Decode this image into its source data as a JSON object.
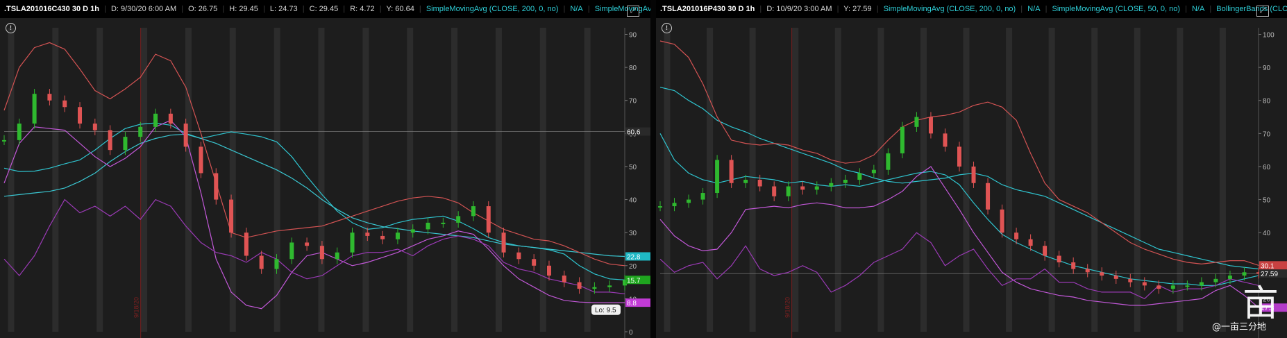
{
  "panels": [
    {
      "header": {
        "symbol": ".TSLA201016C430 30 D 1h",
        "fields": [
          "D: 9/30/20 6:00 AM",
          "O: 26.75",
          "H: 29.45",
          "L: 24.73",
          "C: 29.45",
          "R: 4.72",
          "Y: 60.64"
        ],
        "studies": [
          "SimpleMovingAvg (CLOSE, 200, 0, no)",
          "N/A",
          "SimpleMovingAvg ..."
        ]
      },
      "date_marker": "9/18/20",
      "lo_label": "Lo: 9.5"
    },
    {
      "header": {
        "symbol": ".TSLA201016P430 30 D 1h",
        "fields": [
          "D: 10/9/20 3:00 AM",
          "Y: 27.59"
        ],
        "studies": [
          "SimpleMovingAvg (CLOSE, 200, 0, no)",
          "N/A",
          "SimpleMovingAvg (CLOSE, 50, 0, no)",
          "N/A",
          "BollingerBands (CLOSE,..."
        ]
      },
      "date_marker": "9/18/20"
    }
  ],
  "chart_data": [
    {
      "type": "line",
      "symbol": ".TSLA201016C430",
      "ylim": [
        0,
        92
      ],
      "yticks": [
        0,
        10,
        20,
        30,
        40,
        50,
        60,
        70,
        80,
        90
      ],
      "right_labels": [
        {
          "value": 60.6,
          "text": "60.6",
          "color": "#2a2a2a"
        },
        {
          "value": 22.8,
          "text": "22.8",
          "color": "#1fb8c4"
        },
        {
          "value": 15.7,
          "text": "15.7",
          "color": "#1fa51f"
        },
        {
          "value": 8.8,
          "text": "8.8",
          "color": "#c23bd6"
        }
      ],
      "hline": 60.6,
      "series": [
        {
          "name": "",
          "color": "#2fc4cf",
          "values": [
            49.5,
            48.5,
            48.6,
            49.5,
            50.8,
            52,
            55,
            58.5,
            61.5,
            62.8,
            63.2,
            62.5,
            60,
            58.5,
            59.5,
            60.5,
            59.8,
            59,
            57.5,
            53,
            47,
            41.5,
            36.5,
            33,
            31,
            31.5,
            33,
            34,
            34.5,
            35,
            33.5,
            31.2,
            28.5,
            27,
            26,
            25.5,
            24.8,
            23.5,
            20,
            17.5,
            16,
            15.7
          ]
        },
        {
          "name": "",
          "color": "#3ac7d2",
          "values": [
            41,
            41.5,
            42,
            42.5,
            43.5,
            45.5,
            48,
            51.5,
            54.5,
            57,
            58.5,
            59.5,
            59.8,
            58.5,
            57,
            55,
            53,
            51,
            49,
            46.5,
            43.5,
            40,
            37,
            34.5,
            33,
            31.8,
            31.2,
            30.5,
            30,
            29.5,
            29,
            28.5,
            27.5,
            26.5,
            26,
            25.5,
            25,
            24.5,
            24,
            23.5,
            23,
            22.8
          ]
        },
        {
          "name": "",
          "color": "#d35353",
          "values": [
            67,
            80,
            86,
            87.5,
            85.5,
            79.5,
            73,
            70.5,
            73.5,
            77,
            84,
            82,
            74,
            60,
            45,
            30,
            28.5,
            29.5,
            30.5,
            31,
            31.5,
            32,
            33.5,
            35,
            36.5,
            38,
            39.5,
            40.5,
            41,
            40.5,
            39,
            36,
            33.5,
            31,
            29.5,
            28,
            27.5,
            26,
            24,
            22,
            20.5,
            20
          ]
        },
        {
          "name": "",
          "color": "#c258d8",
          "values": [
            45,
            57,
            62,
            61.5,
            61,
            57,
            53,
            50,
            52.5,
            56,
            62,
            64,
            59,
            42,
            22,
            12,
            8,
            7,
            11,
            18,
            23,
            24,
            22,
            20,
            21,
            22.5,
            24,
            26,
            28,
            29,
            30.5,
            29.5,
            25,
            20,
            16,
            13.5,
            11,
            9.5,
            9,
            8.8,
            8.8,
            8.8
          ]
        },
        {
          "name": "",
          "color": "#9a3ab5",
          "values": [
            22,
            17,
            23,
            32,
            40,
            36,
            38,
            35,
            38,
            34,
            40,
            38,
            32,
            27,
            24,
            23,
            21,
            24,
            22,
            18,
            16,
            17,
            20,
            23,
            24,
            24,
            25,
            23,
            26,
            28,
            29,
            28,
            26,
            21,
            19,
            18,
            16,
            15,
            14,
            12,
            12,
            11.5
          ]
        }
      ],
      "price": [
        58,
        63,
        72,
        70,
        68,
        63,
        61,
        55,
        59,
        62,
        66,
        63,
        56,
        48,
        40,
        30,
        23,
        19,
        22,
        27,
        26,
        22,
        24,
        30,
        29,
        28,
        30,
        31,
        33,
        33,
        35,
        38,
        30,
        24,
        22,
        20,
        17,
        15,
        13,
        13.5,
        14,
        15.7
      ],
      "lo_value": 9.5
    },
    {
      "type": "line",
      "symbol": ".TSLA201016P430",
      "ylim": [
        10,
        102
      ],
      "yticks": [
        20,
        30,
        40,
        50,
        60,
        70,
        80,
        90,
        100
      ],
      "right_labels": [
        {
          "value": 30.1,
          "text": "30.1",
          "color": "#c94141"
        },
        {
          "value": 27.6,
          "text": "27.59",
          "color": "#2a2a2a"
        },
        {
          "value": 17.3,
          "text": "17.3",
          "color": "#b43cc9"
        }
      ],
      "hline": 27.59,
      "series": [
        {
          "name": "",
          "color": "#2fc4cf",
          "values": [
            84,
            83,
            80,
            77.5,
            74,
            72,
            70.5,
            68.5,
            67,
            65.5,
            64,
            62.5,
            61,
            59,
            58,
            56.5,
            55.5,
            55,
            55.5,
            56,
            56.5,
            57.5,
            58,
            57,
            54.5,
            53,
            52,
            51,
            49,
            47,
            45,
            43,
            41,
            39,
            37,
            35,
            34,
            33,
            32,
            31,
            30,
            29.5,
            29
          ]
        },
        {
          "name": "",
          "color": "#2fc4cf",
          "values": [
            70,
            62,
            58,
            56,
            55,
            56,
            57,
            56.5,
            56,
            55,
            55.5,
            54.5,
            54,
            54.5,
            54,
            55,
            56,
            57,
            58,
            58.5,
            57.5,
            54.5,
            49,
            44,
            39.5,
            37,
            35,
            33,
            31.5,
            30,
            29,
            28,
            27,
            26,
            25.5,
            25,
            24.5,
            24.5,
            24,
            24,
            25,
            26,
            27
          ]
        },
        {
          "name": "",
          "color": "#d35353",
          "values": [
            98,
            97,
            93,
            85,
            75,
            68,
            67,
            66.5,
            67,
            66.5,
            65,
            64,
            62,
            61,
            61.5,
            63.5,
            68,
            72,
            74,
            75,
            75.5,
            76.5,
            78.5,
            79.5,
            78,
            74,
            64,
            55,
            50,
            48,
            46,
            43,
            40,
            37,
            35,
            33.5,
            32,
            31,
            30.5,
            31,
            31.5,
            31.5,
            30.1
          ]
        },
        {
          "name": "",
          "color": "#c258d8",
          "values": [
            44,
            39,
            36,
            34.5,
            35,
            40,
            47,
            47.5,
            48,
            47.5,
            48.5,
            49,
            48.5,
            47.5,
            47.5,
            48,
            50,
            52.5,
            57,
            60,
            53.5,
            47,
            40,
            34,
            28,
            25,
            23,
            22,
            21,
            20.5,
            19.5,
            19,
            18.5,
            18,
            18,
            18.5,
            19,
            19.5,
            20,
            22.5,
            24,
            21,
            17.3
          ]
        },
        {
          "name": "",
          "color": "#9a3ab5",
          "values": [
            32,
            28,
            30,
            31,
            26,
            30,
            36,
            29,
            27,
            28,
            30,
            28,
            22,
            24,
            27,
            31,
            33,
            35,
            40,
            37,
            30,
            33,
            35,
            29,
            24,
            26,
            26,
            29,
            25,
            25,
            23,
            22,
            22,
            22,
            20,
            24,
            22,
            23,
            23,
            24,
            26,
            25,
            24
          ]
        }
      ],
      "price": [
        48,
        49,
        50,
        52,
        62,
        55,
        56,
        54,
        51,
        54,
        53,
        54,
        55,
        56,
        58,
        59,
        64,
        72,
        75,
        70,
        66,
        60,
        55,
        47,
        40,
        38,
        36,
        33,
        31,
        29,
        28,
        27,
        26,
        25,
        24,
        23,
        24,
        24,
        25,
        26,
        27,
        28,
        27.6
      ],
      "lo_value": null
    }
  ]
}
